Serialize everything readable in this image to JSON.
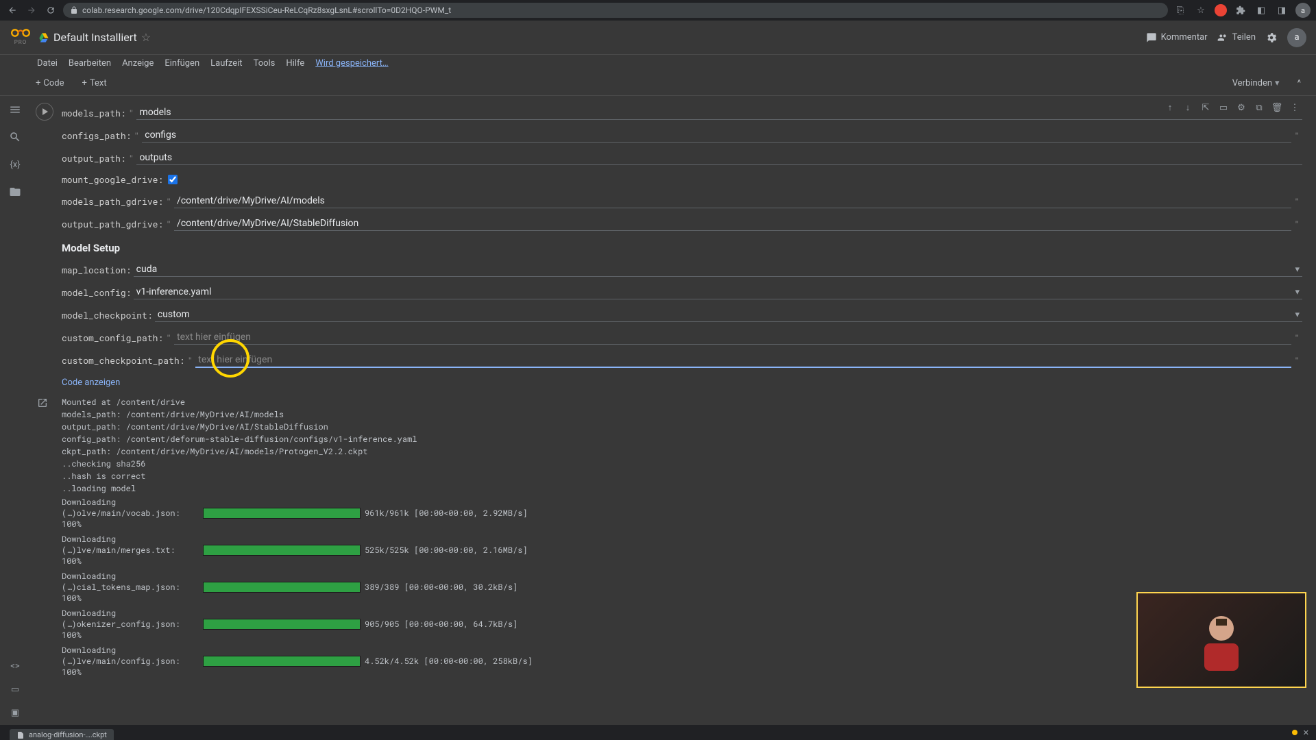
{
  "browser": {
    "url": "colab.research.google.com/drive/120CdqpIFEXSSiCeu-ReLCqRz8sxgLsnL#scrollTo=0D2HQO-PWM_t"
  },
  "header": {
    "title": "Default Installiert",
    "pro": "PRO",
    "comment": "Kommentar",
    "share": "Teilen",
    "avatar_initial": "a"
  },
  "menu": {
    "file": "Datei",
    "edit": "Bearbeiten",
    "view": "Anzeige",
    "insert": "Einfügen",
    "runtime": "Laufzeit",
    "tools": "Tools",
    "help": "Hilfe",
    "saving": "Wird gespeichert…"
  },
  "toolbar": {
    "code": "Code",
    "text": "Text",
    "connect": "Verbinden"
  },
  "form": {
    "models_path_label": "models_path:",
    "models_path_value": "models",
    "configs_path_label": "configs_path:",
    "configs_path_value": "configs",
    "output_path_label": "output_path:",
    "output_path_value": "outputs",
    "mount_label": "mount_google_drive:",
    "mount_checked": true,
    "models_gdrive_label": "models_path_gdrive:",
    "models_gdrive_value": "/content/drive/MyDrive/AI/models",
    "output_gdrive_label": "output_path_gdrive:",
    "output_gdrive_value": "/content/drive/MyDrive/AI/StableDiffusion",
    "section_title": "Model Setup",
    "map_location_label": "map_location:",
    "map_location_value": "cuda",
    "model_config_label": "model_config:",
    "model_config_value": "v1-inference.yaml",
    "model_checkpoint_label": "model_checkpoint:",
    "model_checkpoint_value": "custom",
    "custom_config_label": "custom_config_path:",
    "custom_config_placeholder": "text hier einfügen",
    "custom_checkpoint_label": "custom_checkpoint_path:",
    "custom_checkpoint_placeholder": "text hier einfügen",
    "show_code": "Code anzeigen"
  },
  "output": {
    "text": "Mounted at /content/drive\nmodels_path: /content/drive/MyDrive/AI/models\noutput_path: /content/drive/MyDrive/AI/StableDiffusion\nconfig_path: /content/deforum-stable-diffusion/configs/v1-inference.yaml\nckpt_path: /content/drive/MyDrive/AI/models/Protogen_V2.2.ckpt\n..checking sha256\n..hash is correct\n..loading model",
    "downloads": [
      {
        "label": "Downloading (…)olve/main/vocab.json: 100%",
        "stats": "961k/961k [00:00<00:00, 2.92MB/s]"
      },
      {
        "label": "Downloading (…)lve/main/merges.txt: 100%",
        "stats": "525k/525k [00:00<00:00, 2.16MB/s]"
      },
      {
        "label": "Downloading (…)cial_tokens_map.json: 100%",
        "stats": "389/389 [00:00<00:00, 30.2kB/s]"
      },
      {
        "label": "Downloading (…)okenizer_config.json: 100%",
        "stats": "905/905 [00:00<00:00, 64.7kB/s]"
      },
      {
        "label": "Downloading (…)lve/main/config.json: 100%",
        "stats": "4.52k/4.52k [00:00<00:00, 258kB/s]"
      }
    ]
  },
  "download_chip": "analog-diffusion-….ckpt"
}
